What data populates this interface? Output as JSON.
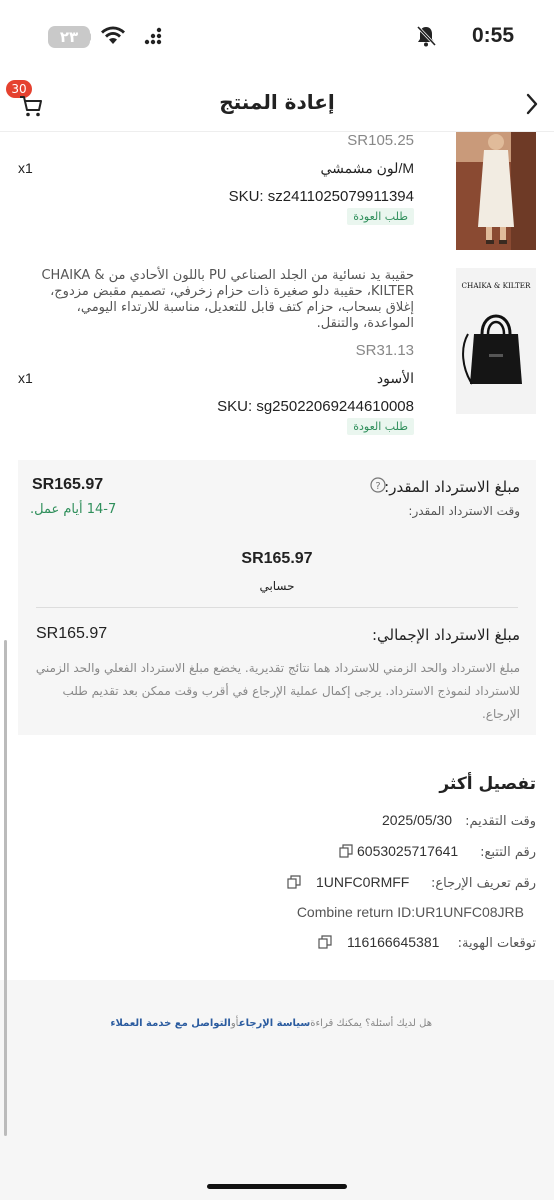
{
  "status": {
    "battery": "٢٣",
    "time": "0:55"
  },
  "nav": {
    "title": "إعادة المنتج",
    "cart_count": "30"
  },
  "products": [
    {
      "price": "SR105.25",
      "variant": "لون مشمشي/M",
      "qty": "x1",
      "sku": "SKU: sz2411025079911394",
      "tag": "طلب العودة"
    },
    {
      "description": "حقيبة يد نسائية من الجلد الصناعي PU باللون الأحادي من CHAIKA & KILTER، حقيبة دلو صغيرة ذات حزام زخرفي، تصميم مقبض مزدوج، إغلاق بسحاب، حزام كتف قابل للتعديل، مناسبة للارتداء اليومي، المواعدة، والتنقل.",
      "brand_logo": "CHAIKA & KILTER",
      "price": "SR31.13",
      "variant": "الأسود",
      "qty": "x1",
      "sku": "SKU: sg25022069244610008",
      "tag": "طلب العودة"
    }
  ],
  "refund": {
    "amount_label": "مبلغ الاسترداد المقدر:",
    "amount_value": "SR165.97",
    "time_label": "وقت الاسترداد المقدر:",
    "time_value": "14-7 أيام عمل.",
    "method_amount": "SR165.97",
    "method_name": "حسابي",
    "total_label": "مبلغ الاسترداد الإجمالي:",
    "total_value": "SR165.97",
    "note": "مبلغ الاسترداد والحد الزمني للاسترداد هما نتائج تقديرية. يخضع مبلغ الاسترداد الفعلي والحد الزمني للاسترداد لنموذج الاسترداد. يرجى إكمال عملية الإرجاع في أقرب وقت ممكن بعد تقديم طلب الإرجاع."
  },
  "details": {
    "title": "تفصيل أكثر",
    "submit_label": "وقت التقديم:",
    "submit_value": "2025/05/30",
    "tracking_label": "رقم التتبع:",
    "tracking_value": "6053025717641",
    "return_id_label": "رقم تعريف الإرجاع:",
    "return_id_value": "1UNFC0RMFF",
    "combine": "Combine return ID:UR1UNFC08JRB",
    "identity_label": "توقعات الهوية:",
    "identity_value": "116166645381"
  },
  "footer": {
    "question": "هل لديك أسئلة؟ يمكنك قراءة",
    "policy_link": "سياسة الإرجاع",
    "or": "أو",
    "contact_link": "التواصل مع خدمة العملاء"
  }
}
